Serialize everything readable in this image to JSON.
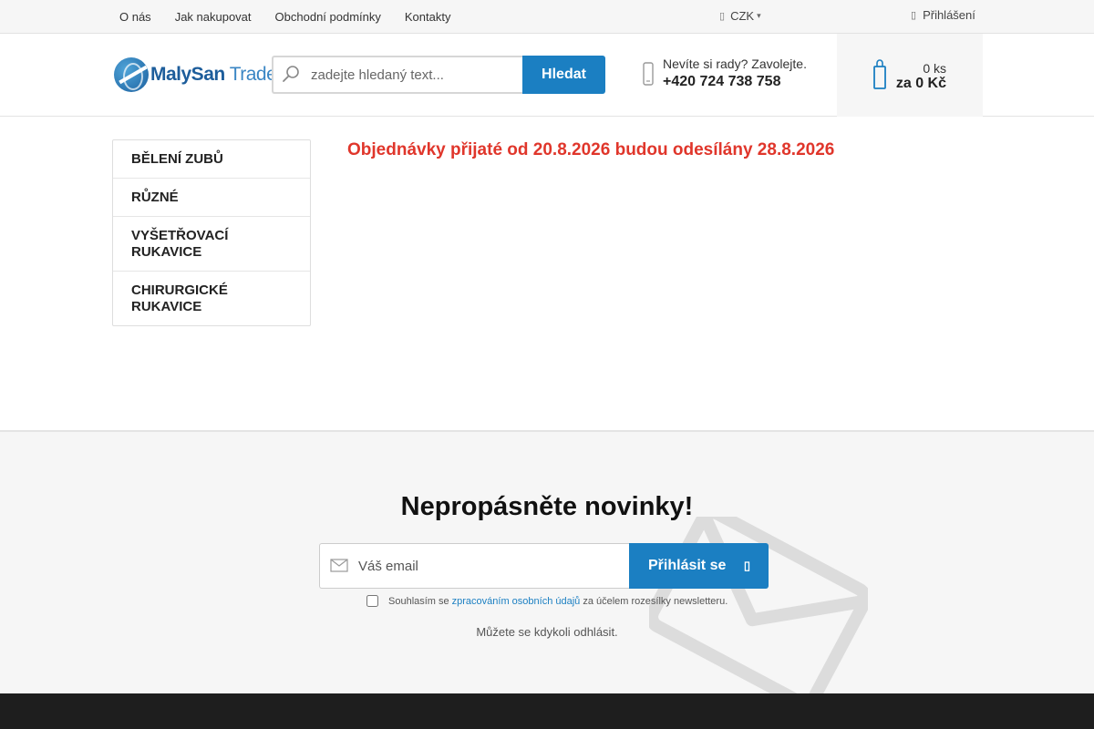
{
  "topbar": {
    "nav": [
      "O nás",
      "Jak nakupovat",
      "Obchodní podmínky",
      "Kontakty"
    ],
    "currency": "CZK",
    "login": "Přihlášení"
  },
  "header": {
    "logo": {
      "brand_part1": "MalySan",
      "brand_part2": "Trade"
    },
    "search": {
      "placeholder": "zadejte hledaný text...",
      "button": "Hledat"
    },
    "help": {
      "question": "Nevíte si rady? Zavolejte.",
      "phone": "+420 724 738 758"
    },
    "cart": {
      "quantity": "0 ks",
      "price": "za 0 Kč"
    }
  },
  "sidebar": {
    "items": [
      "Bělení zubů",
      "Různé",
      "Vyšetřovací rukavice",
      "Chirurgické rukavice"
    ]
  },
  "main": {
    "notice": "Objednávky přijaté od 20.8.2026 budou odesílány 28.8.2026"
  },
  "newsletter": {
    "title": "Nepropásněte novinky!",
    "email_placeholder": "Váš email",
    "submit": "Přihlásit se",
    "consent_before": "Souhlasím se",
    "consent_link": "zpracováním osobních údajů",
    "consent_after": "za účelem rozesílky newsletteru.",
    "unsubscribe": "Můžete se kdykoli odhlásit."
  },
  "colors": {
    "accent": "#1b7fc2",
    "notice": "#e0362b",
    "footer": "#1e1e1e"
  }
}
